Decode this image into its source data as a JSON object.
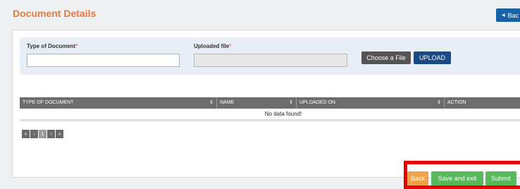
{
  "header": {
    "title": "Document Details",
    "back_button": "Bac"
  },
  "form": {
    "type_label": "Type of Document",
    "file_label": "Uploaded file",
    "required_mark": "*",
    "choose_button": "Choose a File",
    "upload_button": "UPLOAD"
  },
  "table": {
    "columns": [
      "TYPE OF DOCUMENT",
      "NAME",
      "UPLOADED ON",
      "ACTION"
    ],
    "empty_text": "No data found!"
  },
  "pager": {
    "first": "«",
    "prev": "‹",
    "page": "1",
    "next": "›",
    "last": "»"
  },
  "footer": {
    "back": "Back",
    "save_exit": "Save and exit",
    "submit": "Submit"
  },
  "colors": {
    "accent": "#e8793a",
    "primary": "#1a62a8",
    "success": "#57b85c",
    "warning": "#f0a24a",
    "highlight": "#ee0000"
  }
}
